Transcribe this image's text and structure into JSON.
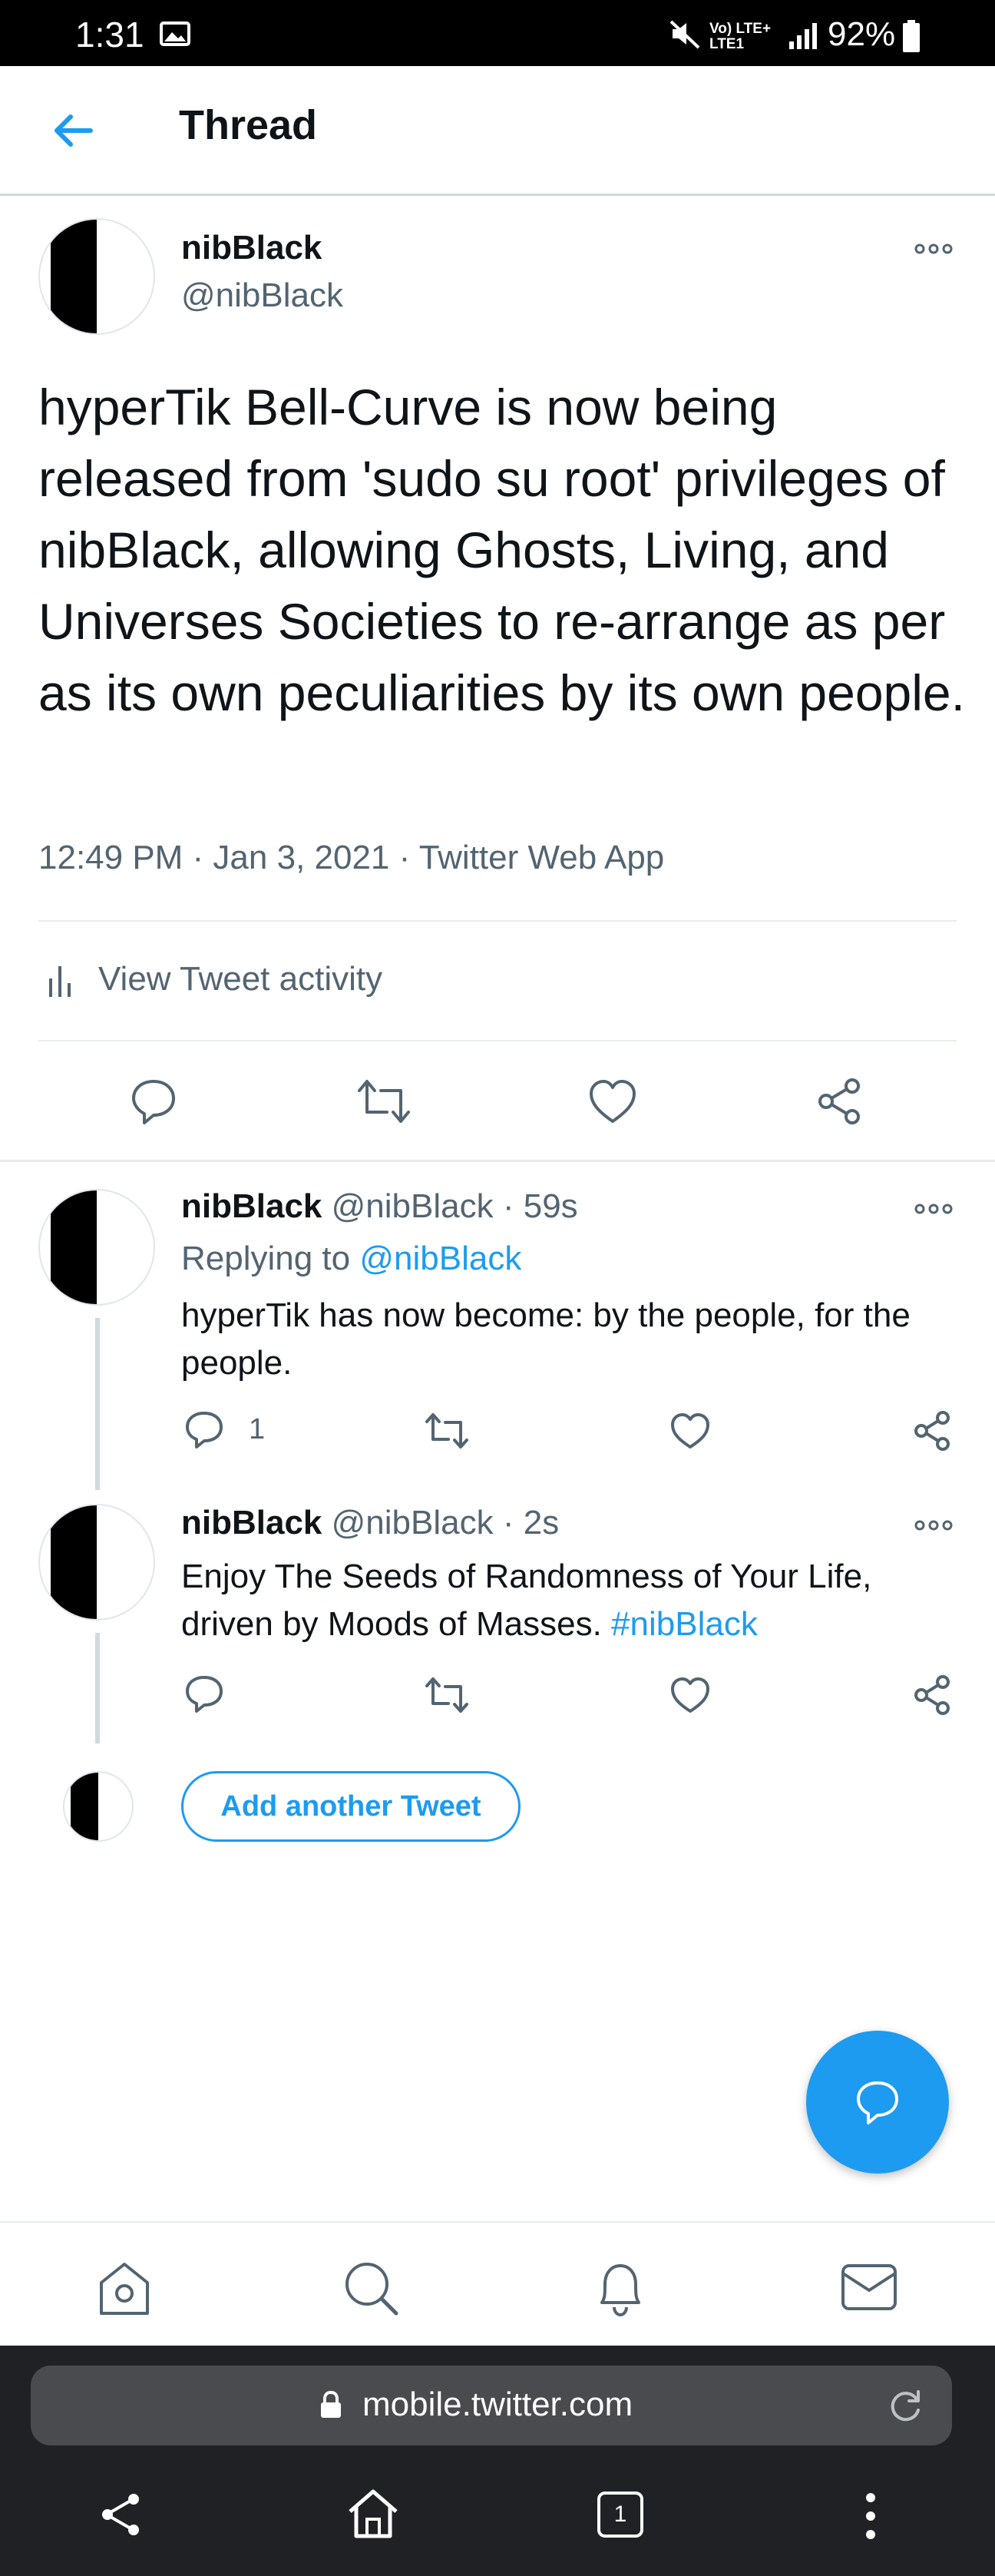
{
  "status_bar": {
    "time": "1:31",
    "battery_percent": "92%",
    "network_line1": "Vo) LTE+",
    "network_line2": "LTE1"
  },
  "header": {
    "title": "Thread",
    "back_icon": "arrow-left-icon"
  },
  "main_tweet": {
    "name": "nibBlack",
    "handle": "@nibBlack",
    "text": "hyperTik Bell-Curve is now being released from 'sudo su root' privileges of nibBlack, allowing Ghosts, Living, and Universes Societies to re-arrange as per as its own peculiarities by its own people.",
    "meta": "12:49 PM · Jan 3, 2021 · Twitter Web App",
    "activity_label": "View Tweet activity"
  },
  "replies": [
    {
      "name": "nibBlack",
      "handle": "@nibBlack",
      "time": "· 59s",
      "replying_prefix": "Replying to",
      "replying_handle": "@nibBlack",
      "text": "hyperTik has now become: by the people, for the people.",
      "reply_count": "1"
    },
    {
      "name": "nibBlack",
      "handle": "@nibBlack",
      "time": "· 2s",
      "text": "Enjoy The Seeds of Randomness of Your Life, driven by Moods of Masses.",
      "hashtag": "#nibBlack"
    }
  ],
  "add_tweet_label": "Add another Tweet",
  "browser": {
    "url": "mobile.twitter.com",
    "tab_count": "1"
  },
  "colors": {
    "accent": "#1d9bf0",
    "text": "#0f1419",
    "secondary": "#536471"
  }
}
